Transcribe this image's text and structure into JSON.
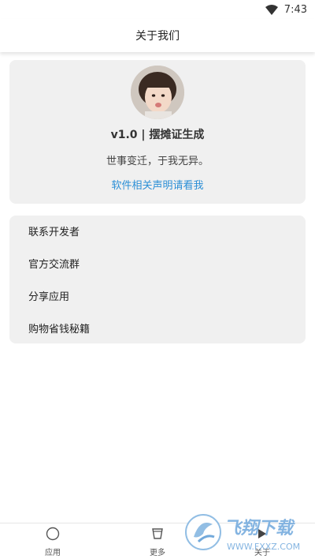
{
  "status_bar": {
    "time": "7:43"
  },
  "app_bar": {
    "title": "关于我们"
  },
  "profile": {
    "version": "v1.0 | 摆摊证生成",
    "motto": "世事变迁，于我无异。",
    "statement_link": "软件相关声明请看我"
  },
  "menu": {
    "items": [
      {
        "label": "联系开发者"
      },
      {
        "label": "官方交流群"
      },
      {
        "label": "分享应用"
      },
      {
        "label": "购物省钱秘籍"
      }
    ]
  },
  "bottom_nav": {
    "items": [
      {
        "label": "应用",
        "icon": "circle-icon"
      },
      {
        "label": "更多",
        "icon": "cup-icon"
      },
      {
        "label": "关于",
        "icon": "info-icon"
      }
    ]
  },
  "watermark": {
    "brand": "飞翔下载",
    "url": "WWW.FXXZ.COM"
  },
  "colors": {
    "link": "#2b8fd6",
    "card": "#f0f0f0"
  }
}
